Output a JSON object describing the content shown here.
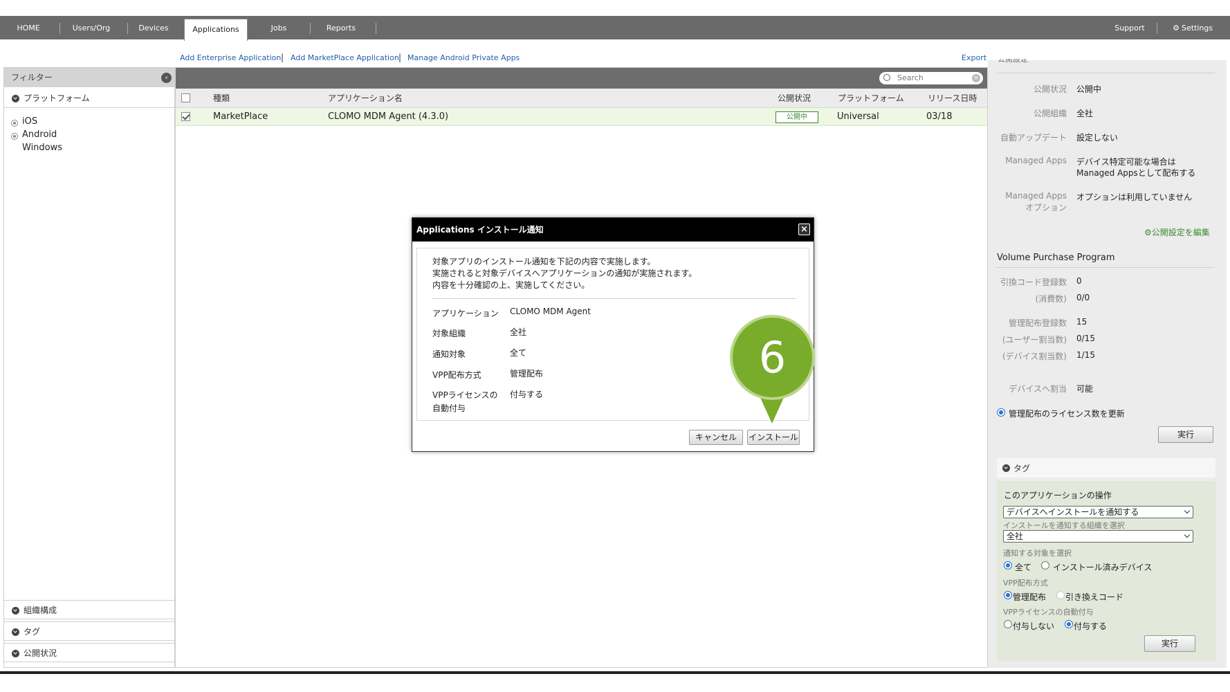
{
  "nav": {
    "items": [
      "HOME",
      "Users/Org",
      "Devices",
      "Applications",
      "Jobs",
      "Reports"
    ],
    "support": "Support",
    "settings": "Settings"
  },
  "sublinks": {
    "add_enterprise": "Add Enterprise Application",
    "add_marketplace": "Add MarketPlace Application",
    "manage_android": "Manage Android Private Apps",
    "export": "Export",
    "separator": "|"
  },
  "sidebar": {
    "filter": "フィルター",
    "platform_section": "プラットフォーム",
    "platforms": [
      "iOS",
      "Android",
      "Windows"
    ],
    "org_section": "組織構成",
    "tag_section": "タグ",
    "publish_section": "公開状況"
  },
  "list": {
    "search_placeholder": "Search",
    "headers": {
      "type": "種類",
      "name": "アプリケーション名",
      "status": "公開状況",
      "platform": "プラットフォーム",
      "release": "リリース日時"
    },
    "rows": [
      {
        "type": "MarketPlace",
        "name": "CLOMO MDM Agent (4.3.0)",
        "status": "公開中",
        "platform": "Universal",
        "release": "03/18"
      }
    ]
  },
  "right_panel": {
    "section_title_partial": "公開設定",
    "publish": [
      {
        "label": "公開状況",
        "value": "公開中"
      },
      {
        "label": "公開組織",
        "value": "全社"
      },
      {
        "label": "自動アップデート",
        "value": "設定しない"
      },
      {
        "label": "Managed Apps",
        "value_line1": "デバイス特定可能な場合は",
        "value_line2": "Managed Appsとして配布する"
      },
      {
        "label_line1": "Managed Apps",
        "label_line2": "オプション",
        "value": "オプションは利用していません"
      }
    ],
    "edit_link": "公開設定を編集",
    "vpp_title": "Volume Purchase Program",
    "vpp": [
      {
        "label": "引換コード登録数",
        "value": "0"
      },
      {
        "label": "(消費数)",
        "value": "0/0"
      },
      {
        "label": "管理配布登録数",
        "value": "15"
      },
      {
        "label": "(ユーザー割当数)",
        "value": "0/15"
      },
      {
        "label": "(デバイス割当数)",
        "value": "1/15"
      },
      {
        "label": "デバイスへ割当",
        "value": "可能"
      }
    ],
    "update_license_radio": "管理配布のライセンス数を更新",
    "run_button": "実行",
    "tag_section": "タグ",
    "operation_title": "このアプリケーションの操作",
    "operation_select": "デバイスへインストールを通知する",
    "org_select_label": "インストールを通知する組織を選択",
    "org_select": "全社",
    "target_label": "通知する対象を選択",
    "target_all": "全て",
    "target_installed": "インストール済みデバイス",
    "vpp_method_label": "VPP配布方式",
    "vpp_managed": "管理配布",
    "vpp_redeem": "引き換えコード",
    "vpp_auto_label": "VPPライセンスの自動付与",
    "vpp_auto_no": "付与しない",
    "vpp_auto_yes": "付与する",
    "run_button2": "実行"
  },
  "modal": {
    "title": "Applications インストール通知",
    "close": "×",
    "intro_line1": "対象アプリのインストール通知を下記の内容で実施します。",
    "intro_line2": "実施されると対象デバイスへアプリケーションの通知が実施されます。",
    "intro_line3": "内容を十分確認の上、実施してください。",
    "rows": [
      {
        "label": "アプリケーション",
        "value": "CLOMO MDM Agent"
      },
      {
        "label": "対象組織",
        "value": "全社"
      },
      {
        "label": "通知対象",
        "value": "全て"
      },
      {
        "label": "VPP配布方式",
        "value": "管理配布"
      },
      {
        "label_line1": "VPPライセンスの",
        "label_line2": "自動付与",
        "value": "付与する"
      }
    ],
    "cancel": "キャンセル",
    "install": "インストール"
  },
  "callout": {
    "number": "6"
  }
}
